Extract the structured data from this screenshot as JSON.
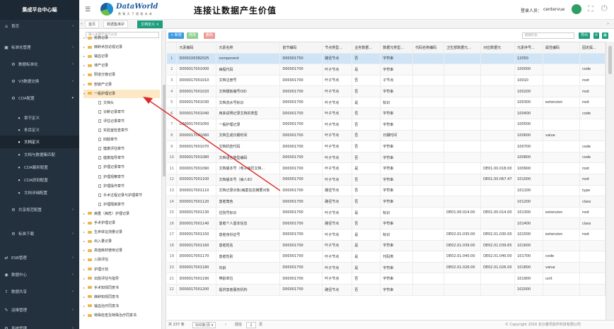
{
  "sidebar": {
    "title": "集成平台中心端",
    "items": [
      {
        "label": "首页",
        "icon": "home-icon",
        "top": true
      },
      {
        "label": "标准化管理",
        "icon": "standard-icon",
        "top": true
      },
      {
        "label": "数据标准化",
        "icon": "gear-icon",
        "sub": true
      },
      {
        "label": "V3数据交换",
        "icon": "gear-icon",
        "sub": true
      },
      {
        "label": "CDA配置",
        "icon": "gear-icon",
        "sub": true,
        "expanded": true
      },
      {
        "label": "章节定义",
        "icon": "circle-icon",
        "sub2": true
      },
      {
        "label": "条目定义",
        "icon": "circle-icon",
        "sub2": true
      },
      {
        "label": "文档定义",
        "icon": "circle-icon",
        "sub2": true,
        "active": true
      },
      {
        "label": "文档与数据集匹配",
        "icon": "circle-icon",
        "sub2": true
      },
      {
        "label": "CDA解析配置",
        "icon": "circle-icon",
        "sub2": true
      },
      {
        "label": "CDA即刻配置",
        "icon": "circle-icon",
        "sub2": true
      },
      {
        "label": "文档详细配置",
        "icon": "circle-icon",
        "sub2": true
      },
      {
        "label": "共享规范配置",
        "icon": "gear-icon",
        "sub": true
      },
      {
        "label": "标准下载",
        "icon": "gear-icon",
        "sub": true
      },
      {
        "label": "ESB管理",
        "icon": "esb-icon",
        "top": true
      },
      {
        "label": "数据中心",
        "icon": "database-icon",
        "top": true
      },
      {
        "label": "数据共享",
        "icon": "share-icon",
        "top": true
      },
      {
        "label": "运维管理",
        "icon": "ops-icon",
        "top": true
      },
      {
        "label": "系统管理",
        "icon": "system-icon",
        "top": true
      }
    ]
  },
  "header": {
    "logo_text": "DataWorld",
    "logo_sub": "数 聚 天 下 赋 能 未 来",
    "slogan": "连接让数据产生价值",
    "user_label": "登录人员：",
    "user_name": "centervue"
  },
  "tabs": [
    {
      "label": "首页"
    },
    {
      "label": "数据集维护"
    },
    {
      "label": "文档定义",
      "active": true
    }
  ],
  "tree": {
    "search_placeholder": "输入关键字进行过滤",
    "nodes": [
      {
        "label": "抢救记录",
        "lvl": 1
      },
      {
        "label": "麻醉术前访视记录",
        "lvl": 1
      },
      {
        "label": "输血记录",
        "lvl": 1
      },
      {
        "label": "待产记录",
        "lvl": 1
      },
      {
        "label": "阴道分娩记录",
        "lvl": 1
      },
      {
        "label": "剖宫产记录",
        "lvl": 1
      },
      {
        "label": "一般护理记录",
        "lvl": 1,
        "open": true,
        "sel": true
      },
      {
        "label": "文档头",
        "lvl": 2
      },
      {
        "label": "诊断记录章节",
        "lvl": 2
      },
      {
        "label": "评估记录章节",
        "lvl": 2
      },
      {
        "label": "实验室检查章节",
        "lvl": 2
      },
      {
        "label": "四肢章节",
        "lvl": 2
      },
      {
        "label": "健康评估章节",
        "lvl": 2
      },
      {
        "label": "健康指导章节",
        "lvl": 2
      },
      {
        "label": "护理记录章节",
        "lvl": 2
      },
      {
        "label": "护理观察章节",
        "lvl": 2
      },
      {
        "label": "护理操作章节",
        "lvl": 2
      },
      {
        "label": "手术过程记录与护理章节",
        "lvl": 2
      },
      {
        "label": "护理隔离章节",
        "lvl": 2
      },
      {
        "label": "病重（病危）护理记录",
        "lvl": 1
      },
      {
        "label": "手术护理记录",
        "lvl": 1
      },
      {
        "label": "生命体征测量记录",
        "lvl": 1
      },
      {
        "label": "出入量记录",
        "lvl": 1
      },
      {
        "label": "高值耗材使用记录",
        "lvl": 1
      },
      {
        "label": "入院评估",
        "lvl": 1
      },
      {
        "label": "护理计划",
        "lvl": 1
      },
      {
        "label": "出院评估与指导",
        "lvl": 1
      },
      {
        "label": "手术知情同意书",
        "lvl": 1
      },
      {
        "label": "麻醉知情同意书",
        "lvl": 1
      },
      {
        "label": "输血治疗同意书",
        "lvl": 1
      },
      {
        "label": "特殊检查及特殊治疗同意书",
        "lvl": 1
      }
    ]
  },
  "toolbar": {
    "add": "+ 新增",
    "edit": "修改",
    "delete": "删除",
    "search_placeholder": "模糊检索",
    "export": "导出"
  },
  "table": {
    "columns": [
      "",
      "元素编码",
      "元素名称",
      "首节编码",
      "节点类型...",
      "业务数据...",
      "数据元类型...",
      "代码名称编码",
      "卫生部数据元...",
      "对应数据元",
      "元素序号...",
      "属性编码",
      "固定属..."
    ],
    "rows": [
      [
        "1",
        "D000100382025",
        "component",
        "D00001750",
        "路径节点",
        "否",
        "字符串",
        "",
        "",
        "",
        "12050",
        "",
        ""
      ],
      [
        "2",
        "D000017001000",
        "病程代码",
        "D00001700",
        "叶子节点",
        "是",
        "字符串",
        "",
        "",
        "",
        "100000",
        "",
        "code"
      ],
      [
        "3",
        "D000017001010",
        "文档注册号",
        "D00001700",
        "叶子节点",
        "否",
        "子节点",
        "",
        "",
        "",
        "10010",
        "",
        "root"
      ],
      [
        "4",
        "D000017001020",
        "文档模板编号OID",
        "D00001700",
        "叶子节点",
        "否",
        "字符串",
        "",
        "",
        "",
        "100200",
        "",
        "root"
      ],
      [
        "5",
        "D000017001030",
        "文档流水号标识",
        "D00001700",
        "叶子节点",
        "是",
        "标识",
        "",
        "",
        "",
        "100300",
        "extension",
        "root"
      ],
      [
        "6",
        "D000017001040",
        "用来说明记录文档的类型",
        "D00001700",
        "叶子节点",
        "否",
        "字符串",
        "",
        "",
        "",
        "100400",
        "",
        "code"
      ],
      [
        "7",
        "D000017001050",
        "一般护理记录",
        "D00001700",
        "叶子节点",
        "否",
        "字符串",
        "",
        "",
        "",
        "100500",
        "",
        ""
      ],
      [
        "8",
        "D000017001060",
        "文档生成日期时间",
        "D00001700",
        "叶子节点",
        "否",
        "日期时间",
        "",
        "",
        "",
        "100600",
        "value",
        ""
      ],
      [
        "9",
        "D000017001070",
        "文档机密代码",
        "D00001700",
        "叶子节点",
        "否",
        "字符串",
        "",
        "",
        "",
        "100700",
        "",
        "code"
      ],
      [
        "10",
        "D000017001080",
        "文档语言类型编码",
        "D00001700",
        "叶子节点",
        "否",
        "字符串",
        "",
        "",
        "",
        "100800",
        "",
        "code"
      ],
      [
        "11",
        "D000017001090",
        "文档版本号（电子病历文档...",
        "D00001700",
        "叶子节点",
        "是",
        "字符串",
        "",
        "",
        "DE01.00.018.00",
        "100900",
        "",
        "root"
      ],
      [
        "12",
        "D000017001100",
        "文档版本号（病人ID）",
        "D00001700",
        "叶子节点",
        "否",
        "字符串",
        "",
        "",
        "DE01.00.067.47",
        "101000",
        "",
        "root"
      ],
      [
        "13",
        "D000017001110",
        "文档记录对象(病案信息摘要对象",
        "D00001700",
        "路径节点",
        "否",
        "字符串",
        "",
        "",
        "",
        "101100",
        "",
        "type"
      ],
      [
        "14",
        "D000017001120",
        "患者角色",
        "D00001700",
        "路径节点",
        "否",
        "字符串",
        "",
        "",
        "",
        "101200",
        "",
        "class"
      ],
      [
        "15",
        "D000017001130",
        "住院号标识",
        "D00001700",
        "叶子节点",
        "是",
        "标识",
        "",
        "DE01.00.014.00",
        "DE01.00.014.00",
        "101300",
        "extension",
        "root"
      ],
      [
        "16",
        "D000017001140",
        "患者个人基本信息",
        "D00001700",
        "路径节点",
        "否",
        "字符串",
        "",
        "",
        "",
        "101400",
        "",
        "class"
      ],
      [
        "17",
        "D000017001150",
        "患者身份证号",
        "D00001700",
        "叶子节点",
        "是",
        "标识",
        "",
        "DE02.01.030.00",
        "DE02.01.030.00",
        "101500",
        "extension",
        "root"
      ],
      [
        "18",
        "D000017001160",
        "患者姓名",
        "D00001700",
        "叶子节点",
        "是",
        "字符串",
        "",
        "DE02.01.039.00",
        "DE02.01.039.65",
        "101600",
        "",
        ""
      ],
      [
        "19",
        "D000017001170",
        "患者性别",
        "D00001700",
        "叶子节点",
        "是",
        "代码类",
        "",
        "DE02.01.040.00",
        "DE02.01.040.00",
        "101700",
        "code",
        ""
      ],
      [
        "20",
        "D000017001180",
        "年龄",
        "D00001700",
        "叶子节点",
        "是",
        "字符串",
        "",
        "DE02.01.026.00",
        "DE02.01.026.00",
        "101800",
        "value",
        ""
      ],
      [
        "21",
        "D000017001190",
        "带龄单位",
        "D00001700",
        "叶子节点",
        "否",
        "字符串",
        "",
        "",
        "",
        "101900",
        "unit",
        ""
      ],
      [
        "22",
        "D000017001200",
        "提供患者服务机构",
        "D00001700",
        "路径节点",
        "否",
        "字符串",
        "",
        "",
        "",
        "102000",
        "",
        ""
      ]
    ]
  },
  "footer": {
    "total": "共 237 条",
    "page_size": "500条/页",
    "prev_label": "前往",
    "page": "1",
    "page_suffix": "页",
    "copyright": "© Copyright 2016 长沙康讯软件科技有限公司"
  },
  "colors": {
    "sidebar_bg": "#23313e",
    "accent_green": "#1e9e7c",
    "add_blue": "#3b9ae1",
    "edit_green": "#5cb85c",
    "delete_red": "#e86c63",
    "arrow": "#e02828",
    "selected_row": "#cfe5f7"
  }
}
